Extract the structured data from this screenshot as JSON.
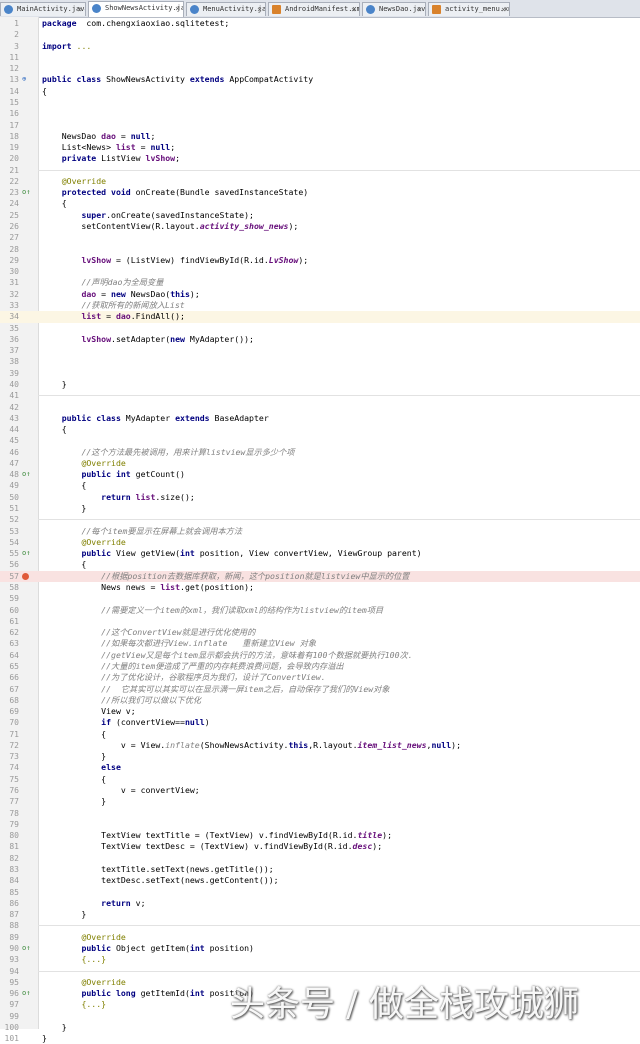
{
  "tabs": [
    {
      "label": "MainActivity.java",
      "active": false,
      "icon": "java-file-icon"
    },
    {
      "label": "ShowNewsActivity.java",
      "active": true,
      "icon": "java-file-icon"
    },
    {
      "label": "MenuActivity.java",
      "active": false,
      "icon": "java-file-icon"
    },
    {
      "label": "AndroidManifest.xml",
      "active": false,
      "icon": "xml-file-icon"
    },
    {
      "label": "NewsDao.java",
      "active": false,
      "icon": "java-file-icon"
    },
    {
      "label": "activity_menu.xml",
      "active": false,
      "icon": "xml-file-icon"
    }
  ],
  "tab_close_glyph": "×",
  "lines": [
    {
      "n": "1",
      "segs": [
        [
          "kw",
          "package"
        ],
        [
          "",
          "  com.chengxiaoxiao.sqlitetest;"
        ]
      ]
    },
    {
      "n": "2",
      "segs": []
    },
    {
      "n": "3",
      "segs": [
        [
          "kw",
          "import"
        ],
        [
          "",
          " "
        ],
        [
          "an",
          "..."
        ]
      ]
    },
    {
      "n": "11",
      "segs": []
    },
    {
      "n": "12",
      "segs": []
    },
    {
      "n": "13",
      "segs": [
        [
          "kw",
          "public class"
        ],
        [
          "",
          " ShowNewsActivity "
        ],
        [
          "kw",
          "extends"
        ],
        [
          "",
          " AppCompatActivity"
        ]
      ]
    },
    {
      "n": "14",
      "segs": [
        [
          "",
          "{"
        ]
      ]
    },
    {
      "n": "15",
      "segs": []
    },
    {
      "n": "16",
      "segs": []
    },
    {
      "n": "17",
      "segs": []
    },
    {
      "n": "18",
      "segs": [
        [
          "",
          "    NewsDao "
        ],
        [
          "fb",
          "dao"
        ],
        [
          "",
          " = "
        ],
        [
          "kw",
          "null"
        ],
        [
          "",
          ";"
        ]
      ]
    },
    {
      "n": "19",
      "segs": [
        [
          "",
          "    List<News> "
        ],
        [
          "fb",
          "list"
        ],
        [
          "",
          " = "
        ],
        [
          "kw",
          "null"
        ],
        [
          "",
          ";"
        ]
      ]
    },
    {
      "n": "20",
      "segs": [
        [
          "",
          "    "
        ],
        [
          "kw",
          "private"
        ],
        [
          "",
          " ListView "
        ],
        [
          "fb",
          "lvShow"
        ],
        [
          "",
          ";"
        ]
      ]
    },
    {
      "n": "21",
      "segs": []
    },
    {
      "n": "22",
      "segs": [
        [
          "",
          "    "
        ],
        [
          "an",
          "@Override"
        ]
      ]
    },
    {
      "n": "23",
      "segs": [
        [
          "",
          "    "
        ],
        [
          "kw",
          "protected void"
        ],
        [
          "",
          " onCreate(Bundle savedInstanceState)"
        ]
      ]
    },
    {
      "n": "24",
      "segs": [
        [
          "",
          "    {"
        ]
      ]
    },
    {
      "n": "25",
      "segs": [
        [
          "",
          "        "
        ],
        [
          "kw",
          "super"
        ],
        [
          "",
          ".onCreate(savedInstanceState);"
        ]
      ]
    },
    {
      "n": "26",
      "segs": [
        [
          "",
          "        setContentView(R.layout."
        ],
        [
          "fld",
          "activity_show_news"
        ],
        [
          "",
          ");"
        ]
      ]
    },
    {
      "n": "27",
      "segs": []
    },
    {
      "n": "28",
      "segs": []
    },
    {
      "n": "29",
      "segs": [
        [
          "",
          "        "
        ],
        [
          "fb",
          "lvShow"
        ],
        [
          "",
          " = (ListView) findViewById(R.id."
        ],
        [
          "fld",
          "LvShow"
        ],
        [
          "",
          ");"
        ]
      ]
    },
    {
      "n": "30",
      "segs": []
    },
    {
      "n": "31",
      "segs": [
        [
          "",
          "        "
        ],
        [
          "cm",
          "//声明dao为全局变量"
        ]
      ]
    },
    {
      "n": "32",
      "segs": [
        [
          "",
          "        "
        ],
        [
          "fb",
          "dao"
        ],
        [
          "",
          " = "
        ],
        [
          "kw",
          "new"
        ],
        [
          "",
          " NewsDao("
        ],
        [
          "kw",
          "this"
        ],
        [
          "",
          ");"
        ]
      ]
    },
    {
      "n": "33",
      "segs": [
        [
          "",
          "        "
        ],
        [
          "cm",
          "//获取所有的新闻放入List"
        ]
      ]
    },
    {
      "n": "34",
      "segs": [
        [
          "",
          "        "
        ],
        [
          "fb",
          "list"
        ],
        [
          "",
          " = "
        ],
        [
          "fb",
          "dao"
        ],
        [
          "",
          ".FindAll();"
        ]
      ]
    },
    {
      "n": "35",
      "segs": []
    },
    {
      "n": "36",
      "segs": [
        [
          "",
          "        "
        ],
        [
          "fb",
          "lvShow"
        ],
        [
          "",
          ".setAdapter("
        ],
        [
          "kw",
          "new"
        ],
        [
          "",
          " MyAdapter());"
        ]
      ]
    },
    {
      "n": "37",
      "segs": []
    },
    {
      "n": "38",
      "segs": []
    },
    {
      "n": "39",
      "segs": []
    },
    {
      "n": "40",
      "segs": [
        [
          "",
          "    }"
        ]
      ]
    },
    {
      "n": "41",
      "segs": []
    },
    {
      "n": "42",
      "segs": []
    },
    {
      "n": "43",
      "segs": [
        [
          "",
          "    "
        ],
        [
          "kw",
          "public class"
        ],
        [
          "",
          " MyAdapter "
        ],
        [
          "kw",
          "extends"
        ],
        [
          "",
          " BaseAdapter"
        ]
      ]
    },
    {
      "n": "44",
      "segs": [
        [
          "",
          "    {"
        ]
      ]
    },
    {
      "n": "45",
      "segs": []
    },
    {
      "n": "46",
      "segs": [
        [
          "",
          "        "
        ],
        [
          "cm",
          "//这个方法最先被调用，用来计算listview显示多少个项"
        ]
      ]
    },
    {
      "n": "47",
      "segs": [
        [
          "",
          "        "
        ],
        [
          "an",
          "@Override"
        ]
      ]
    },
    {
      "n": "48",
      "segs": [
        [
          "",
          "        "
        ],
        [
          "kw",
          "public int"
        ],
        [
          "",
          " getCount()"
        ]
      ]
    },
    {
      "n": "49",
      "segs": [
        [
          "",
          "        {"
        ]
      ]
    },
    {
      "n": "50",
      "segs": [
        [
          "",
          "            "
        ],
        [
          "kw",
          "return"
        ],
        [
          "",
          " "
        ],
        [
          "fb",
          "list"
        ],
        [
          "",
          ".size();"
        ]
      ]
    },
    {
      "n": "51",
      "segs": [
        [
          "",
          "        }"
        ]
      ]
    },
    {
      "n": "52",
      "segs": []
    },
    {
      "n": "53",
      "segs": [
        [
          "",
          "        "
        ],
        [
          "cm",
          "//每个item要显示在屏幕上就会调用本方法"
        ]
      ]
    },
    {
      "n": "54",
      "segs": [
        [
          "",
          "        "
        ],
        [
          "an",
          "@Override"
        ]
      ]
    },
    {
      "n": "55",
      "segs": [
        [
          "",
          "        "
        ],
        [
          "kw",
          "public"
        ],
        [
          "",
          " View getView("
        ],
        [
          "kw",
          "int"
        ],
        [
          "",
          " position, View convertView, ViewGroup parent)"
        ]
      ]
    },
    {
      "n": "56",
      "segs": [
        [
          "",
          "        {"
        ]
      ]
    },
    {
      "n": "57",
      "segs": [
        [
          "",
          "            "
        ],
        [
          "cm",
          "//根据position去数据库获取，新闻，这个position就是listview中显示的位置"
        ]
      ]
    },
    {
      "n": "58",
      "segs": [
        [
          "",
          "            News news = "
        ],
        [
          "fb",
          "list"
        ],
        [
          "",
          ".get(position);"
        ]
      ]
    },
    {
      "n": "59",
      "segs": []
    },
    {
      "n": "60",
      "segs": [
        [
          "",
          "            "
        ],
        [
          "cm",
          "//需要定义一个item的xml，我们读取xml的结构作为listview的item项目"
        ]
      ]
    },
    {
      "n": "61",
      "segs": []
    },
    {
      "n": "62",
      "segs": [
        [
          "",
          "            "
        ],
        [
          "cm",
          "//这个ConvertView就是进行优化使用的"
        ]
      ]
    },
    {
      "n": "63",
      "segs": [
        [
          "",
          "            "
        ],
        [
          "cm",
          "//如果每次都进行View.inflate   重新建立View 对象"
        ]
      ]
    },
    {
      "n": "64",
      "segs": [
        [
          "",
          "            "
        ],
        [
          "cm",
          "//getView又是每个item显示都会执行的方法，意味着有100个数据就要执行100次."
        ]
      ]
    },
    {
      "n": "65",
      "segs": [
        [
          "",
          "            "
        ],
        [
          "cm",
          "//大量的item便造成了严重的内存耗费浪费问题，会导致内存溢出"
        ]
      ]
    },
    {
      "n": "66",
      "segs": [
        [
          "",
          "            "
        ],
        [
          "cm",
          "//为了优化设计，谷歌程序员为我们，设计了ConvertView."
        ]
      ]
    },
    {
      "n": "67",
      "segs": [
        [
          "",
          "            "
        ],
        [
          "cm",
          "//  它其实可以其实可以在显示满一屏item之后，自动保存了我们的View对象"
        ]
      ]
    },
    {
      "n": "68",
      "segs": [
        [
          "",
          "            "
        ],
        [
          "cm",
          "//所以我们可以做以下优化"
        ]
      ]
    },
    {
      "n": "69",
      "segs": [
        [
          "",
          "            View v;"
        ]
      ]
    },
    {
      "n": "70",
      "segs": [
        [
          "",
          "            "
        ],
        [
          "kw",
          "if"
        ],
        [
          "",
          " (convertView=="
        ],
        [
          "kw",
          "null"
        ],
        [
          "",
          ")"
        ]
      ]
    },
    {
      "n": "71",
      "segs": [
        [
          "",
          "            {"
        ]
      ]
    },
    {
      "n": "72",
      "segs": [
        [
          "",
          "                v = View."
        ],
        [
          "cm",
          "inflate"
        ],
        [
          "",
          "(ShowNewsActivity."
        ],
        [
          "kw",
          "this"
        ],
        [
          "",
          ",R.layout."
        ],
        [
          "fld",
          "item_list_news"
        ],
        [
          "",
          ","
        ],
        [
          "kw",
          "null"
        ],
        [
          "",
          ");"
        ]
      ]
    },
    {
      "n": "73",
      "segs": [
        [
          "",
          "            }"
        ]
      ]
    },
    {
      "n": "74",
      "segs": [
        [
          "",
          "            "
        ],
        [
          "kw",
          "else"
        ]
      ]
    },
    {
      "n": "75",
      "segs": [
        [
          "",
          "            {"
        ]
      ]
    },
    {
      "n": "76",
      "segs": [
        [
          "",
          "                v = convertView;"
        ]
      ]
    },
    {
      "n": "77",
      "segs": [
        [
          "",
          "            }"
        ]
      ]
    },
    {
      "n": "78",
      "segs": []
    },
    {
      "n": "79",
      "segs": []
    },
    {
      "n": "80",
      "segs": [
        [
          "",
          "            TextView textTitle = (TextView) v.findViewById(R.id."
        ],
        [
          "fld",
          "title"
        ],
        [
          "",
          ");"
        ]
      ]
    },
    {
      "n": "81",
      "segs": [
        [
          "",
          "            TextView textDesc = (TextView) v.findViewById(R.id."
        ],
        [
          "fld",
          "desc"
        ],
        [
          "",
          ");"
        ]
      ]
    },
    {
      "n": "82",
      "segs": []
    },
    {
      "n": "83",
      "segs": [
        [
          "",
          "            textTitle.setText(news.getTitle());"
        ]
      ]
    },
    {
      "n": "84",
      "segs": [
        [
          "",
          "            textDesc.setText(news.getContent());"
        ]
      ]
    },
    {
      "n": "85",
      "segs": []
    },
    {
      "n": "86",
      "segs": [
        [
          "",
          "            "
        ],
        [
          "kw",
          "return"
        ],
        [
          "",
          " v;"
        ]
      ]
    },
    {
      "n": "87",
      "segs": [
        [
          "",
          "        }"
        ]
      ]
    },
    {
      "n": "88",
      "segs": []
    },
    {
      "n": "89",
      "segs": [
        [
          "",
          "        "
        ],
        [
          "an",
          "@Override"
        ]
      ]
    },
    {
      "n": "90",
      "segs": [
        [
          "",
          "        "
        ],
        [
          "kw",
          "public"
        ],
        [
          "",
          " Object getItem("
        ],
        [
          "kw",
          "int"
        ],
        [
          "",
          " position)"
        ]
      ]
    },
    {
      "n": "93",
      "segs": [
        [
          "",
          "        "
        ],
        [
          "an",
          "{...}"
        ]
      ]
    },
    {
      "n": "94",
      "segs": []
    },
    {
      "n": "95",
      "segs": [
        [
          "",
          "        "
        ],
        [
          "an",
          "@Override"
        ]
      ]
    },
    {
      "n": "96",
      "segs": [
        [
          "",
          "        "
        ],
        [
          "kw",
          "public long"
        ],
        [
          "",
          " getItemId("
        ],
        [
          "kw",
          "int"
        ],
        [
          "",
          " position)"
        ]
      ]
    },
    {
      "n": "97",
      "segs": [
        [
          "",
          "        "
        ],
        [
          "an",
          "{...}"
        ]
      ]
    },
    {
      "n": "99",
      "segs": []
    },
    {
      "n": "100",
      "segs": [
        [
          "",
          "    }"
        ]
      ]
    },
    {
      "n": "101",
      "segs": [
        [
          "",
          "}"
        ]
      ]
    }
  ],
  "gutter_markers": [
    {
      "line": "13",
      "type": "impl",
      "glyph": "⊕"
    },
    {
      "line": "23",
      "type": "override",
      "glyph": "o↑"
    },
    {
      "line": "48",
      "type": "override",
      "glyph": "o↑"
    },
    {
      "line": "55",
      "type": "override",
      "glyph": "o↑"
    },
    {
      "line": "57",
      "type": "breakpoint",
      "glyph": ""
    },
    {
      "line": "90",
      "type": "override",
      "glyph": "o↑"
    },
    {
      "line": "96",
      "type": "override",
      "glyph": "o↑"
    }
  ],
  "highlighted_line": "34",
  "error_line": "57",
  "watermark": "头条号 / 做全栈攻城狮",
  "colors": {
    "keyword": "#000080",
    "comment": "#808080",
    "annotation": "#808000",
    "field": "#660e7a",
    "breakpoint": "#e05a3a"
  }
}
